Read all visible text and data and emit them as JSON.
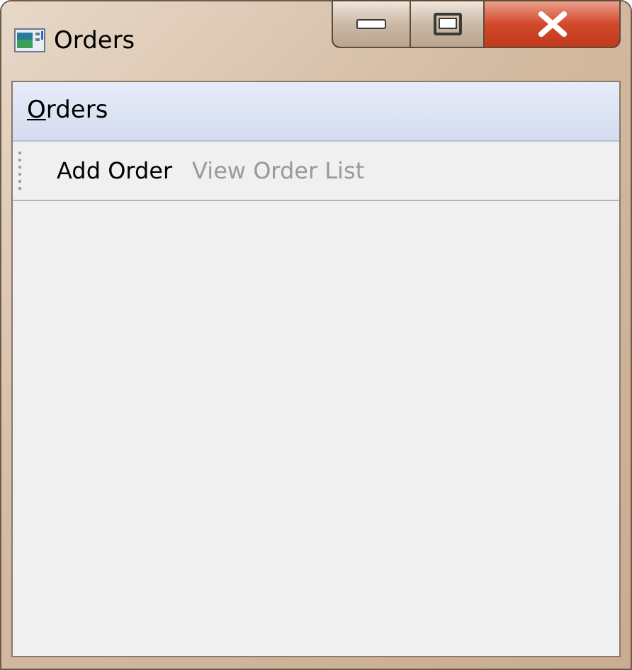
{
  "window": {
    "title": "Orders"
  },
  "menu": [
    {
      "label_parts": [
        {
          "text": "O",
          "underlined": true
        },
        {
          "text": "rders",
          "underlined": false
        }
      ]
    }
  ],
  "toolbar": [
    {
      "label": "Add Order",
      "disabled": false
    },
    {
      "label": "View Order List",
      "disabled": true
    }
  ]
}
